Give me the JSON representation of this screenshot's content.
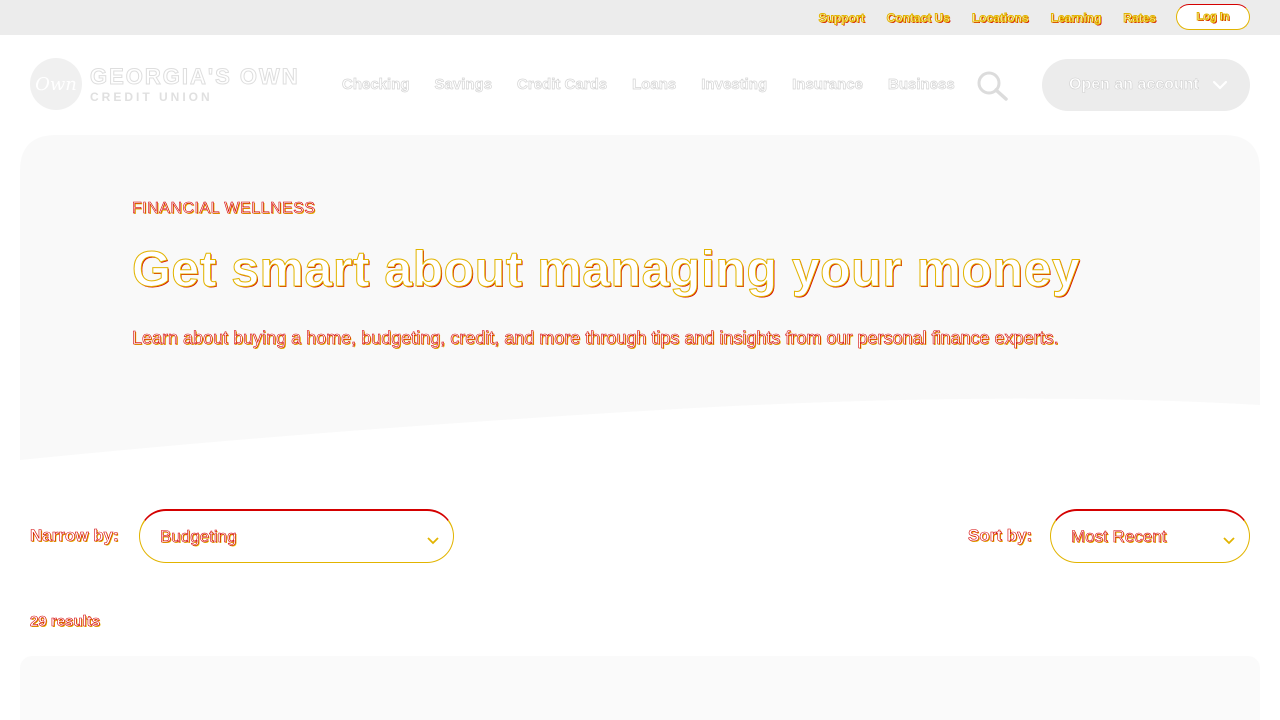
{
  "utility": {
    "links": [
      "Support",
      "Contact Us",
      "Locations",
      "Learning",
      "Rates"
    ],
    "login_label": "Log In"
  },
  "brand": {
    "logo_mark": "Own",
    "name": "GEORGIA'S OWN",
    "subname": "CREDIT UNION"
  },
  "nav": {
    "items": [
      "Checking",
      "Savings",
      "Credit Cards",
      "Loans",
      "Investing",
      "Insurance",
      "Business"
    ],
    "open_account_label": "Open an account"
  },
  "hero": {
    "eyebrow": "FINANCIAL WELLNESS",
    "title": "Get smart about managing your money",
    "description": "Learn about buying a home, budgeting, credit, and more through tips and insights from our personal finance experts."
  },
  "filters": {
    "narrow_label": "Narrow by:",
    "narrow_value": "Budgeting",
    "sort_label": "Sort by:",
    "sort_value": "Most Recent"
  },
  "results": {
    "label": "29 results"
  },
  "colors": {
    "accent_yellow": "#e2b400",
    "accent_red": "#d40000",
    "hero_bg": "#f9f9f9",
    "utility_bg": "#ececec"
  },
  "icons": {
    "search": "search-icon",
    "chevron": "chevron-down-icon"
  }
}
